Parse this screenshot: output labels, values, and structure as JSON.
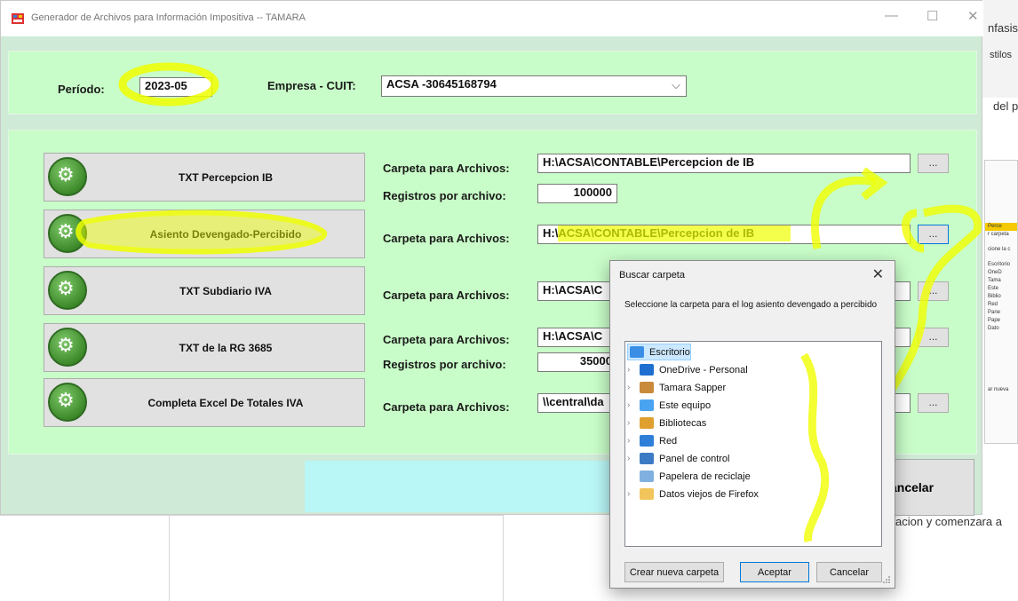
{
  "background_doc": {
    "snippets": [
      "nfasis",
      "stilos",
      "del p",
      "acion y comenzara a"
    ],
    "side_panel": [
      "Perce",
      "r carpeta",
      "cione la c",
      "Escritorio",
      "OneD",
      "Tama",
      "Este",
      "Biblio",
      "Red",
      "Pane",
      "Pape",
      "Dato",
      "ar nueva"
    ]
  },
  "window": {
    "title": "Generador de Archivos para Información Impositiva  --  TAMARA",
    "controls": {
      "minimize": "—",
      "maximize": "☐",
      "close": "✕"
    }
  },
  "header": {
    "periodo_label": "Período:",
    "periodo_value": "2023-05",
    "empresa_label": "Empresa - CUIT:",
    "empresa_value": "ACSA  -30645168794",
    "dropdown_arrow": "⌵"
  },
  "rows": [
    {
      "button": "TXT Percepcion IB",
      "folder_label": "Carpeta para Archivos:",
      "folder_value": "H:\\ACSA\\CONTABLE\\Percepcion de IB",
      "records_label": "Registros por archivo:",
      "records_value": "100000"
    },
    {
      "button": "Asiento Devengado-Percibido",
      "folder_label": "Carpeta para Archivos:",
      "folder_value": "H:\\ACSA\\CONTABLE\\Percepcion de IB"
    },
    {
      "button": "TXT Subdiario IVA",
      "folder_label": "Carpeta para Archivos:",
      "folder_value": "H:\\ACSA\\C"
    },
    {
      "button": "TXT de la RG 3685",
      "folder_label": "Carpeta para Archivos:",
      "folder_value": "H:\\ACSA\\C",
      "records_label": "Registros por archivo:",
      "records_value": "35000"
    },
    {
      "button": "Completa Excel De Totales IVA",
      "folder_label": "Carpeta para Archivos:",
      "folder_value": "\\\\central\\da"
    }
  ],
  "browse_label": "...",
  "cancel_button": "ancelar",
  "dialog": {
    "title": "Buscar carpeta",
    "close": "✕",
    "description": "Seleccione la carpeta para el log asiento devengado a percibido",
    "tree": [
      {
        "label": "Escritorio",
        "icon": "desktop-icon",
        "color": "#3a8ee6",
        "expandable": false,
        "selected": true
      },
      {
        "label": "OneDrive - Personal",
        "icon": "cloud-icon",
        "color": "#1e6fd0",
        "expandable": true
      },
      {
        "label": "Tamara Sapper",
        "icon": "user-icon",
        "color": "#c98a3a",
        "expandable": true
      },
      {
        "label": "Este equipo",
        "icon": "computer-icon",
        "color": "#4aa3f0",
        "expandable": true
      },
      {
        "label": "Bibliotecas",
        "icon": "library-icon",
        "color": "#e0a030",
        "expandable": true
      },
      {
        "label": "Red",
        "icon": "network-icon",
        "color": "#2f7fd8",
        "expandable": true
      },
      {
        "label": "Panel de control",
        "icon": "control-panel-icon",
        "color": "#3c7bc4",
        "expandable": true
      },
      {
        "label": "Papelera de reciclaje",
        "icon": "recycle-bin-icon",
        "color": "#7fb0e0",
        "expandable": false
      },
      {
        "label": "Datos viejos de Firefox",
        "icon": "folder-icon",
        "color": "#f2c55c",
        "expandable": true
      }
    ],
    "buttons": {
      "new_folder": "Crear nueva carpeta",
      "accept": "Aceptar",
      "cancel": "Cancelar"
    }
  },
  "colors": {
    "panel": "#c8fcc8",
    "window": "#cfead6",
    "highlight": "#f0ff00",
    "cyan_bar": "#b9f6f6"
  }
}
